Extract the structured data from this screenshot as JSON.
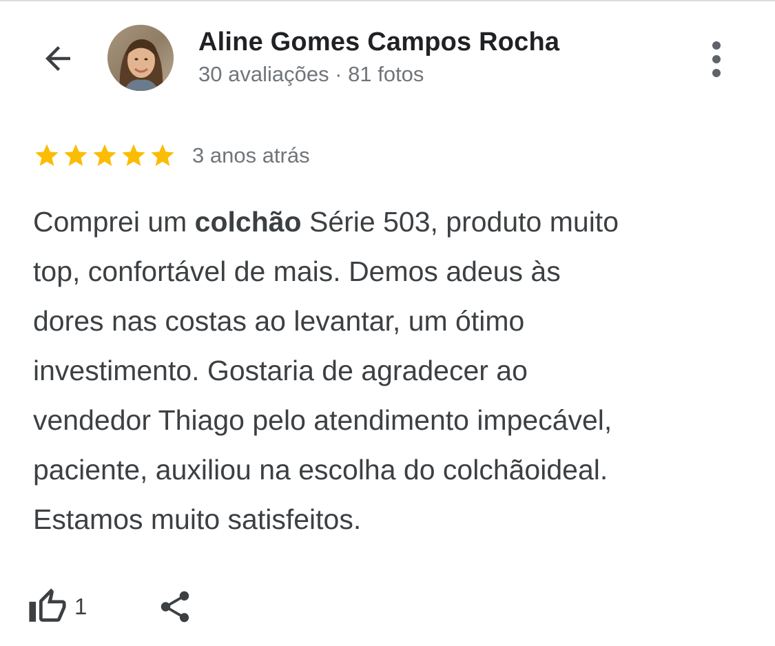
{
  "header": {
    "back_icon": "arrow-back-icon",
    "reviewer_name": "Aline Gomes Campos Rocha",
    "reviewer_stats": "30 avaliações · 81 fotos",
    "more_icon": "more-vert-icon"
  },
  "review": {
    "rating": 5,
    "rating_max": 5,
    "star_color": "#fbbc04",
    "time": "3 anos atrás",
    "text_parts": {
      "p1": "Comprei um ",
      "bold": "colchão",
      "p2": " Série 503, produto muito",
      "l2": "top, confortável de mais. Demos adeus às",
      "l3": "dores nas costas ao levantar, um ótimo",
      "l4": "investimento. Gostaria de agradecer ao",
      "l5": "vendedor Thiago pelo atendimento impecável,",
      "l6": "paciente, auxiliou na escolha do colchãoideal.",
      "l7": "Estamos muito satisfeitos."
    }
  },
  "actions": {
    "like_icon": "thumb-up-icon",
    "like_count": "1",
    "share_icon": "share-icon"
  }
}
